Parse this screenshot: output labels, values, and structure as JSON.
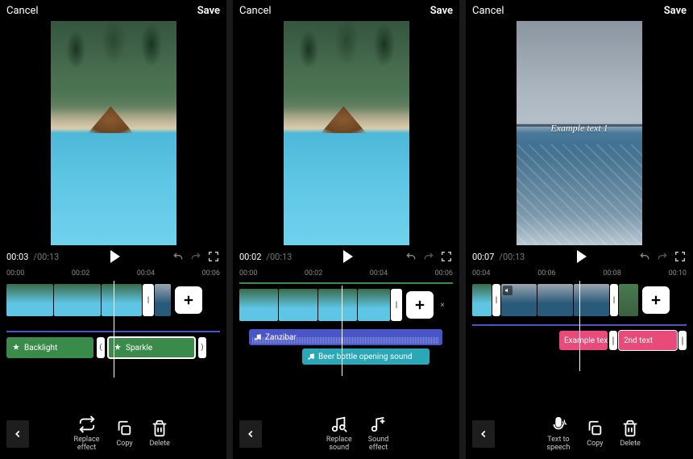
{
  "common": {
    "cancel": "Cancel",
    "save": "Save",
    "totalTime": "/00:13"
  },
  "screen1": {
    "currentTime": "00:03",
    "ticks": [
      "00:00",
      "00:02",
      "00:04",
      "00:06"
    ],
    "effect1": "Backlight",
    "effect2": "Sparkle",
    "tools": {
      "replace": "Replace\neffect",
      "copy": "Copy",
      "delete": "Delete"
    }
  },
  "screen2": {
    "currentTime": "00:02",
    "ticks": [
      "00:00",
      "00:02",
      "00:04",
      "00:06"
    ],
    "sound1": "Zanzibar",
    "sound2": "Beer bottle opening sound",
    "tools": {
      "replace": "Replace\nsound",
      "effect": "Sound\neffect"
    }
  },
  "screen3": {
    "currentTime": "00:07",
    "ticks": [
      "00:04",
      "00:06",
      "00:08",
      "00:10"
    ],
    "overlayText": "Example text 1",
    "text1": "Example tex",
    "text2": "2nd text",
    "tools": {
      "tts": "Text to\nspeech",
      "copy": "Copy",
      "delete": "Delete"
    }
  }
}
